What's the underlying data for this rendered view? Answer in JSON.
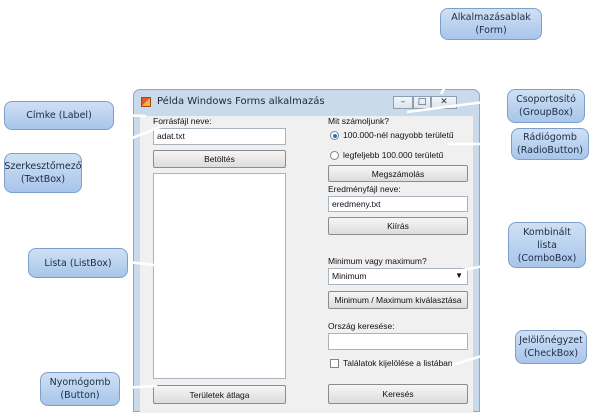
{
  "window": {
    "title": "Példa Windows Forms alkalmazás",
    "controls": {
      "minimize": "–",
      "maximize": "□",
      "close": "✕"
    }
  },
  "form": {
    "source_label": "Forrásfájl neve:",
    "source_value": "adat.txt",
    "load_button": "Betöltés",
    "group_label": "Mit számoljunk?",
    "radio_1": "100.000-nél nagyobb területű",
    "radio_2": "legfeljebb 100.000 területű",
    "radio_1_selected": true,
    "count_button": "Megszámolás",
    "result_label": "Eredményfájl neve:",
    "result_value": "eredmeny.txt",
    "write_button": "Kiírás",
    "minmax_label": "Minimum vagy maximum?",
    "minmax_value": "Minimum",
    "minmax_button": "Minimum / Maximum kiválasztása",
    "search_label": "Ország keresése:",
    "search_value": "",
    "highlight_checkbox": "Találatok kijelölése a listában",
    "highlight_checked": false,
    "average_button": "Területek átlaga",
    "search_button": "Keresés"
  },
  "callouts": {
    "form": "Alkalmazásablak\n(Form)",
    "label": "Címke (Label)",
    "groupbox": "Csoportosító\n(GroupBox)",
    "radiobutton": "Rádiógomb\n(RadioButton)",
    "textbox": "Szerkesztőmező\n(TextBox)",
    "listbox": "Lista (ListBox)",
    "combobox": "Kombinált\nlista\n(ComboBox)",
    "checkbox": "Jelölőnégyzet\n(CheckBox)",
    "button": "Nyomógomb\n(Button)"
  },
  "colors": {
    "callout_fill": "#b9d1f0",
    "window_frame": "#c9daea",
    "client_bg": "#f0f0f0",
    "pointer": "#ffffff"
  }
}
